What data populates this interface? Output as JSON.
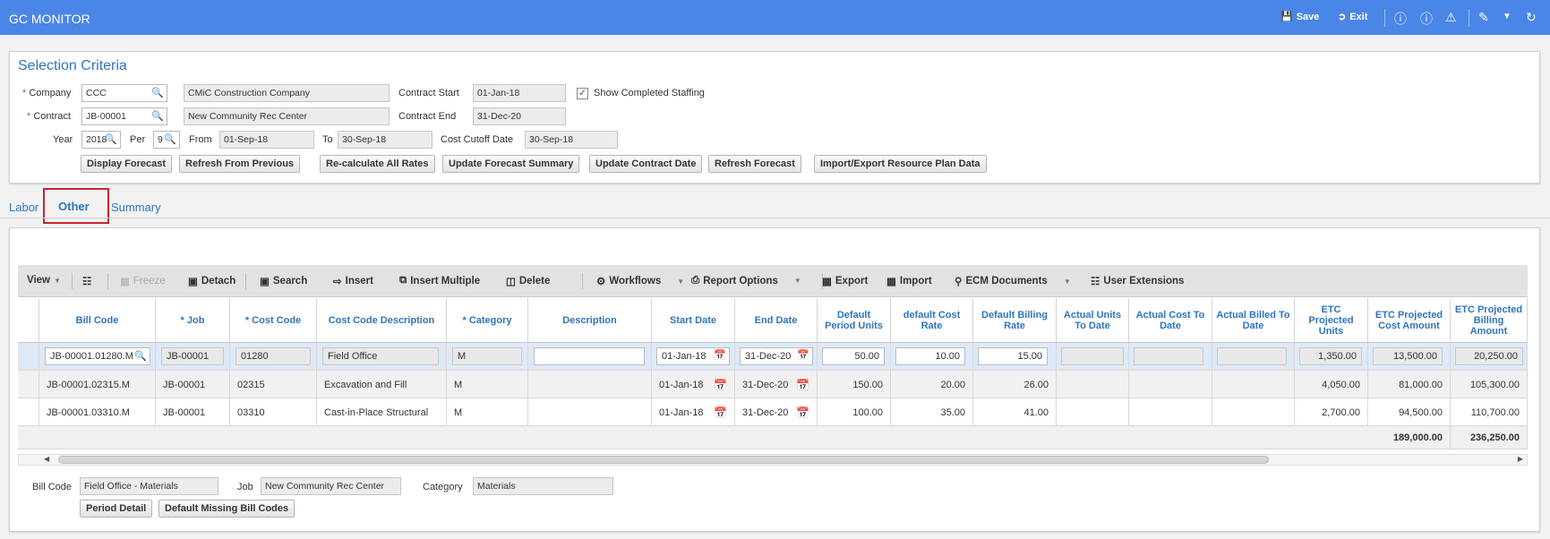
{
  "app": {
    "title": "GC MONITOR",
    "save_label": "Save",
    "exit_label": "Exit"
  },
  "selection": {
    "title": "Selection Criteria",
    "company_label": "Company",
    "company_code": "CCC",
    "company_name": "CMiC Construction Company",
    "contract_start_label": "Contract Start",
    "contract_start": "01-Jan-18",
    "show_completed_label": "Show Completed Staffing",
    "show_completed_checked": true,
    "contract_label": "Contract",
    "contract_code": "JB-00001",
    "contract_name": "New Community Rec Center",
    "contract_end_label": "Contract End",
    "contract_end": "31-Dec-20",
    "year_label": "Year",
    "year": "2018",
    "per_label": "Per",
    "per": "9",
    "from_label": "From",
    "from": "01-Sep-18",
    "to_label": "To",
    "to": "30-Sep-18",
    "cutoff_label": "Cost Cutoff Date",
    "cutoff": "30-Sep-18",
    "buttons": {
      "display_forecast": "Display Forecast",
      "refresh_previous": "Refresh From Previous",
      "recalculate": "Re-calculate All Rates",
      "update_summary": "Update Forecast Summary",
      "update_contract_date": "Update Contract Date",
      "refresh_forecast": "Refresh Forecast",
      "import_export": "Import/Export Resource Plan Data"
    }
  },
  "tabs": {
    "labor": "Labor",
    "other": "Other",
    "summary": "Summary"
  },
  "toolbar": {
    "view": "View",
    "freeze": "Freeze",
    "detach": "Detach",
    "search": "Search",
    "insert": "Insert",
    "insert_multiple": "Insert Multiple",
    "delete": "Delete",
    "workflows": "Workflows",
    "report_options": "Report Options",
    "export": "Export",
    "import": "Import",
    "ecm_documents": "ECM Documents",
    "user_extensions": "User Extensions"
  },
  "grid": {
    "headers": {
      "bill_code": "Bill Code",
      "job": "* Job",
      "cost_code": "* Cost Code",
      "cost_desc": "Cost Code Description",
      "category": "* Category",
      "description": "Description",
      "start_date": "Start Date",
      "end_date": "End Date",
      "period_units": "Default Period Units",
      "cost_rate": "default Cost Rate",
      "billing_rate": "Default Billing Rate",
      "actual_units": "Actual Units To Date",
      "actual_cost": "Actual Cost To Date",
      "actual_billed": "Actual Billed To Date",
      "etc_units": "ETC Projected Units",
      "etc_cost": "ETC Projected Cost Amount",
      "etc_billing": "ETC Projected Billing Amount"
    },
    "rows": [
      {
        "bill_code": "JB-00001.01280.M",
        "job": "JB-00001",
        "cost_code": "01280",
        "cost_desc": "Field Office",
        "category": "M",
        "description": "",
        "start_date": "01-Jan-18",
        "end_date": "31-Dec-20",
        "period_units": "50.00",
        "cost_rate": "10.00",
        "billing_rate": "15.00",
        "actual_units": "",
        "actual_cost": "",
        "actual_billed": "",
        "etc_units": "1,350.00",
        "etc_cost": "13,500.00",
        "etc_billing": "20,250.00"
      },
      {
        "bill_code": "JB-00001.02315.M",
        "job": "JB-00001",
        "cost_code": "02315",
        "cost_desc": "Excavation and Fill",
        "category": "M",
        "description": "",
        "start_date": "01-Jan-18",
        "end_date": "31-Dec-20",
        "period_units": "150.00",
        "cost_rate": "20.00",
        "billing_rate": "26.00",
        "actual_units": "",
        "actual_cost": "",
        "actual_billed": "",
        "etc_units": "4,050.00",
        "etc_cost": "81,000.00",
        "etc_billing": "105,300.00"
      },
      {
        "bill_code": "JB-00001.03310.M",
        "job": "JB-00001",
        "cost_code": "03310",
        "cost_desc": "Cast-in-Place Structural",
        "category": "M",
        "description": "",
        "start_date": "01-Jan-18",
        "end_date": "31-Dec-20",
        "period_units": "100.00",
        "cost_rate": "35.00",
        "billing_rate": "41.00",
        "actual_units": "",
        "actual_cost": "",
        "actual_billed": "",
        "etc_units": "2,700.00",
        "etc_cost": "94,500.00",
        "etc_billing": "110,700.00"
      }
    ],
    "totals": {
      "etc_cost": "189,000.00",
      "etc_billing": "236,250.00"
    }
  },
  "detail": {
    "bill_code_label": "Bill Code",
    "bill_code_value": "Field Office - Materials",
    "job_label": "Job",
    "job_value": "New Community Rec Center",
    "category_label": "Category",
    "category_value": "Materials",
    "period_detail": "Period Detail",
    "default_missing": "Default Missing Bill Codes"
  }
}
